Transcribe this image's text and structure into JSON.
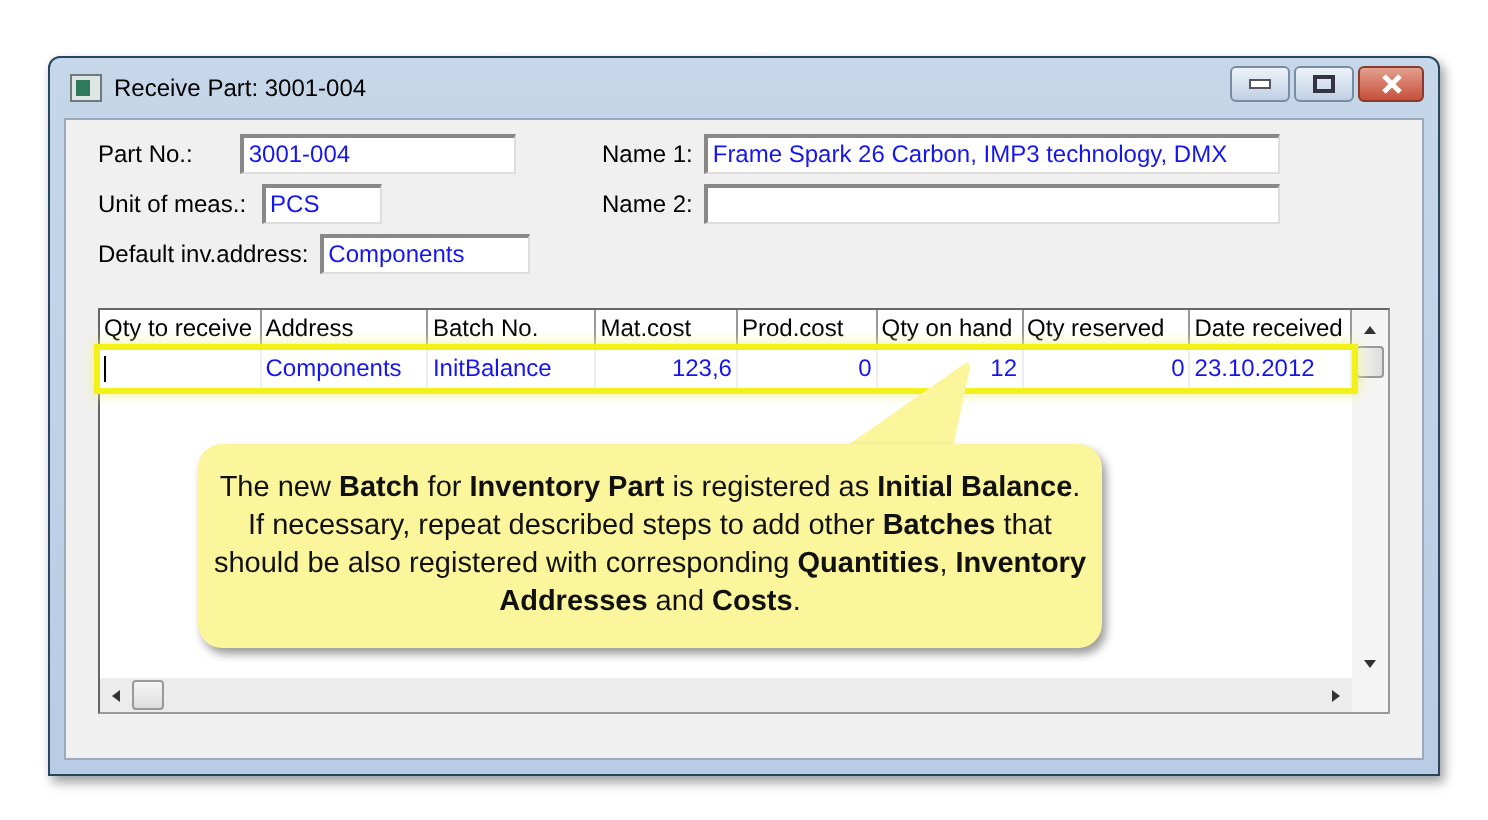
{
  "window": {
    "title": "Receive Part: 3001-004"
  },
  "fields_left": [
    {
      "label": "Part No.:",
      "value": "3001-004"
    },
    {
      "label": "Unit of meas.:",
      "value": "PCS"
    },
    {
      "label": "Default inv.address:",
      "value": "Components"
    }
  ],
  "fields_right": [
    {
      "label": "Name 1:",
      "value": "Frame Spark 26 Carbon, IMP3 technology, DMX"
    },
    {
      "label": "Name 2:"
    }
  ],
  "table": {
    "columns": [
      "Qty to receive",
      "Address",
      "Batch No.",
      "Mat.cost",
      "Prod.cost",
      "Qty on hand",
      "Qty reserved",
      "Date received"
    ],
    "rows": [
      {
        "highlighted": true,
        "cells": [
          {
            "kind": "input"
          },
          {
            "kind": "text",
            "value": "Components"
          },
          {
            "kind": "text",
            "value": "InitBalance"
          },
          {
            "kind": "number",
            "value": "123,6"
          },
          {
            "kind": "number",
            "value": "0"
          },
          {
            "kind": "number",
            "value": "12"
          },
          {
            "kind": "number",
            "value": "0"
          },
          {
            "kind": "text",
            "value": "23.10.2012"
          }
        ]
      }
    ]
  },
  "callout": {
    "text": "The new **Batch** for **Inventory Part** is registered as **Initial Balance**.  If necessary, repeat described steps to add other **Batches** that should be also registered with corresponding **Quantities**, **Inventory Addresses** and **Costs**."
  }
}
